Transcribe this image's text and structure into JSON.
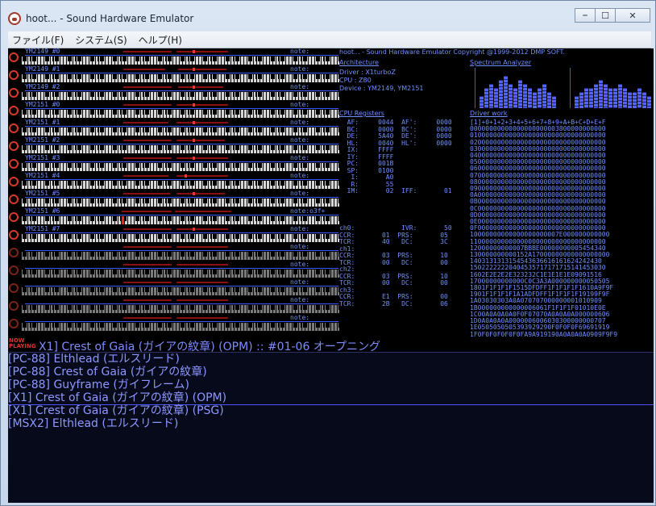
{
  "window": {
    "title": "hoot... - Sound Hardware Emulator",
    "minimize": "⎯",
    "maximize": "☐",
    "close": "✕"
  },
  "menu": [
    "ファイル(F)",
    "システム(S)",
    "ヘルプ(H)"
  ],
  "channels": [
    {
      "name": "YM2149 #0",
      "note": "note:",
      "active": true
    },
    {
      "name": "YM2149 #1",
      "note": "note:",
      "active": true
    },
    {
      "name": "YM2149 #2",
      "note": "note:",
      "active": true
    },
    {
      "name": "YM2151 #0",
      "note": "note:",
      "active": true
    },
    {
      "name": "YM2151 #1",
      "note": "note:",
      "active": true
    },
    {
      "name": "YM2151 #2",
      "note": "note:",
      "active": true
    },
    {
      "name": "YM2151 #3",
      "note": "note:",
      "active": true
    },
    {
      "name": "YM2151 #4",
      "note": "note:",
      "active": true
    },
    {
      "name": "YM2151 #5",
      "note": "note:",
      "active": true
    },
    {
      "name": "YM2151 #6",
      "note": "note:o3f+",
      "active": true
    },
    {
      "name": "YM2151 #7",
      "note": "note:",
      "active": true
    },
    {
      "name": "",
      "note": "note:",
      "active": false
    },
    {
      "name": "",
      "note": "note:",
      "active": false
    },
    {
      "name": "",
      "note": "note:",
      "active": false
    },
    {
      "name": "",
      "note": "note:",
      "active": false
    },
    {
      "name": "",
      "note": "note:",
      "active": false
    }
  ],
  "info": {
    "header": "hoot... - Sound Hardware Emulator Copyright @1999-2012 DMP SOFT.",
    "architecture_label": "Architecture",
    "driver": "Driver : X1turboZ",
    "cpu": "CPU    : Z80",
    "device": "Device : YM2149, YM2151",
    "spectrum_label": "Spectrum Analyzer",
    "cpu_registers_label": "CPU Registers",
    "driver_work_label": "Driver work"
  },
  "registers": [
    "  AF:     0044  AF':     0000",
    "  BC:     0000  BC':     0000",
    "  DE:     5A40  DE':     0000",
    "  HL:     0040  HL':     0000",
    "  IX:     FFFF",
    "  IY:     FFFF",
    "  PC:     001B",
    "  SP:     0100",
    "   I:       A0",
    "   R:       55",
    "  IM:       02  IFF:       01"
  ],
  "timers": [
    "ch0:            IVR:       50",
    "CCR:       01  PRS:       05",
    "TCR:       40   DC:       3C",
    "ch1:",
    "CCR:       03  PRS:       10",
    "TCR:       00   DC:       00",
    "ch2:",
    "CCR:       03  PRS:       10",
    "TCR:       00   DC:       00",
    "ch3:",
    "CCR:       E1  PRS:       00",
    "TCR:       2B   DC:       06"
  ],
  "driver_work": [
    "[1]+0+1+2+3+4+5+6+7+8+9+A+B+C+D+E+F",
    "00000000000000000000003800000000000",
    "01000000000000000000000000000000000",
    "02000000000000000000000000000000000",
    "03000000000000000000000000000000000",
    "04000000000000000000000000000000000",
    "05000000000000000000000000000000000",
    "06000000000000000000000000000000000",
    "07000000000000000000000000000000000",
    "08000000000000000000000000000000000",
    "09000000000000000000000000000000000",
    "0A000000000000000000000000000000000",
    "0B000000000000000000000000000000000",
    "0C000000000000000000000000000000000",
    "0D000000000000000000000000000000000",
    "0E000000000000000000000000000000000",
    "0F000000000000000000000000000000000",
    "10000000000000000000007E000000000000",
    "11000000000000000000000000000000000",
    "12000000000007BBBE00000000005454340",
    "130000000000152A17000000000000000000",
    "1403131313154543636616161624242430",
    "15022222220404535717171715141453030",
    "1602E2E2E2E323232C1E1E1E1E09091516",
    "17000000000000C0C3A3A000000000050505",
    "1801F1F1F1F1515DFDFF1F1F1F1F1610A9F9F",
    "1901F1F1F1F1A1ADFDFF1F1F1F1F19199F9F",
    "1A03030303A0A070707000000001010909",
    "1B000000000000006061F1F1F1F01010E0E",
    "1C00A0A0A0A0F0F07070A0A0A0A000000606",
    "1D0A0A0A0A0000006006030300000000707",
    "1E0505050505393929290F0F0F0F69691919",
    "1F0F0F0F0F0F0FA9A919190A0A0A0A0909F9F9"
  ],
  "spectrum": {
    "left": [
      3,
      5,
      6,
      5,
      7,
      8,
      6,
      5,
      7,
      6,
      5,
      4,
      5,
      6,
      4,
      3
    ],
    "right": [
      3,
      4,
      5,
      5,
      6,
      7,
      6,
      5,
      5,
      6,
      5,
      4,
      4,
      5,
      4,
      3
    ],
    "max": 10
  },
  "now_playing": {
    "badge_top": "NOW",
    "badge_bottom": "PLAYING",
    "text": "X1] Crest of Gaia (ガイアの紋章) (OPM) :: #01-06 オープニング"
  },
  "playlist": [
    {
      "label": "[PC-88] Elthlead (エルスリード)",
      "selected": false
    },
    {
      "label": "[PC-88] Crest of Gaia (ガイアの紋章)",
      "selected": false
    },
    {
      "label": "[PC-88] Guyframe (ガイフレーム)",
      "selected": false
    },
    {
      "label": "[X1] Crest of Gaia (ガイアの紋章) (OPM)",
      "selected": true
    },
    {
      "label": "[X1] Crest of Gaia (ガイアの紋章) (PSG)",
      "selected": false
    },
    {
      "label": "[MSX2] Elthlead (エルスリード)",
      "selected": false
    }
  ]
}
